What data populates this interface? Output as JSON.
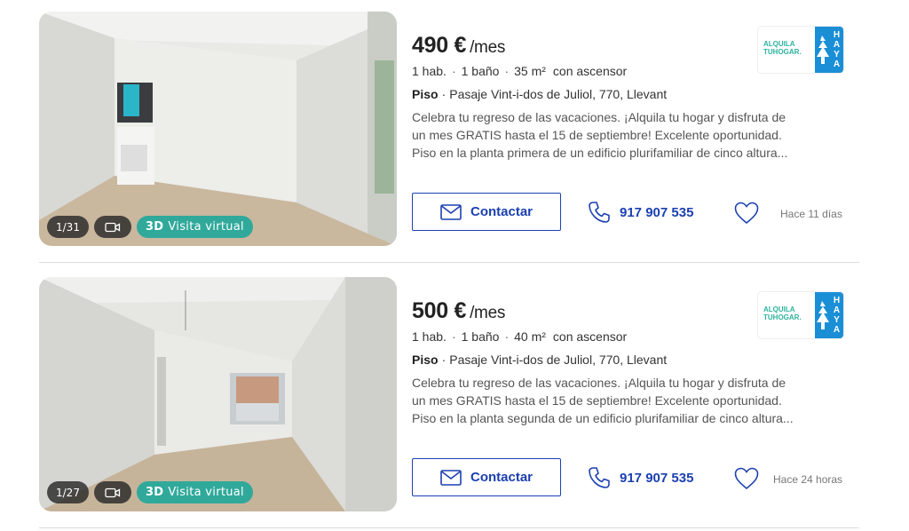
{
  "listings": [
    {
      "price": "490 €",
      "price_unit": "/mes",
      "rooms": "1 hab.",
      "baths": "1 baño",
      "area": "35 m²",
      "elevator": "con ascensor",
      "type": "Piso",
      "address": "Pasaje Vint-i-dos de Juliol, 770, Llevant",
      "description": "Celebra tu regreso de las vacaciones. ¡Alquila tu hogar y disfruta de un mes GRATIS hasta el 15 de septiembre! Excelente oportunidad. Piso en la planta primera de un edificio plurifamiliar de cinco altura...",
      "photo_count": "1/31",
      "tour_label": "Visita virtual",
      "tour_prefix": "3D",
      "contact_label": "Contactar",
      "phone": "917 907 535",
      "time_ago": "Hace 11 días",
      "logo_line1": "ALQUILA",
      "logo_line2": "TUHOGAR.",
      "logo_brand": "HAYA"
    },
    {
      "price": "500 €",
      "price_unit": "/mes",
      "rooms": "1 hab.",
      "baths": "1 baño",
      "area": "40 m²",
      "elevator": "con ascensor",
      "type": "Piso",
      "address": "Pasaje Vint-i-dos de Juliol, 770, Llevant",
      "description": "Celebra tu regreso de las vacaciones. ¡Alquila tu hogar y disfruta de un mes GRATIS hasta el 15 de septiembre! Excelente oportunidad. Piso en la planta segunda de un edificio plurifamiliar de cinco altura...",
      "photo_count": "1/27",
      "tour_label": "Visita virtual",
      "tour_prefix": "3D",
      "contact_label": "Contactar",
      "phone": "917 907 535",
      "time_ago": "Hace 24 horas",
      "logo_line1": "ALQUILA",
      "logo_line2": "TUHOGAR.",
      "logo_brand": "HAYA"
    }
  ],
  "colors": {
    "accent": "#1c40b0",
    "tour_badge": "#30a99b",
    "logo_green": "#2db39e",
    "logo_blue": "#1a8fd6"
  },
  "icons": {
    "contact": "envelope-icon",
    "phone": "phone-icon",
    "favorite": "heart-icon",
    "video": "video-camera-icon"
  }
}
